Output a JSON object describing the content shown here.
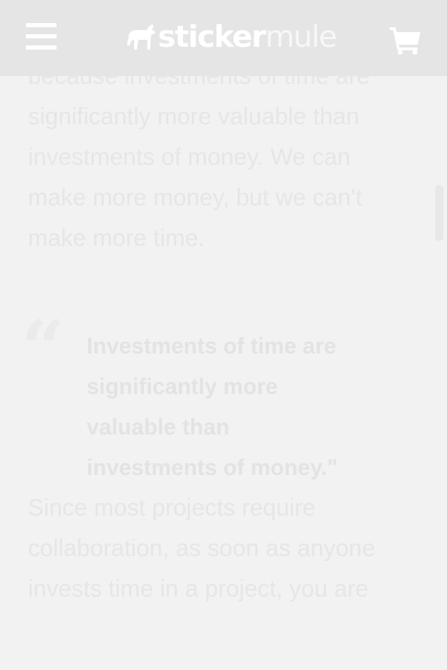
{
  "header": {
    "logo": {
      "part1": "sticker",
      "part2": "mule"
    },
    "menu_icon": "hamburger-menu-icon",
    "cart_icon": "shopping-cart-icon"
  },
  "article": {
    "para1_lines": [
      "because investments of time are",
      "significantly more valuable than",
      "investments of money. We can",
      "make more money, but we can't",
      "make more time."
    ],
    "quote_mark": "“",
    "quote_lines": [
      "Investments of time are",
      "significantly more",
      "valuable than",
      "investments of money.\""
    ],
    "para2_lines": [
      "Since most projects require",
      "collaboration, as soon as anyone",
      "invests time in a project, you are"
    ]
  },
  "colors": {
    "header_bg": "#e5e5e5",
    "page_bg": "#f2f2f2",
    "text": "#e6e6e6"
  }
}
